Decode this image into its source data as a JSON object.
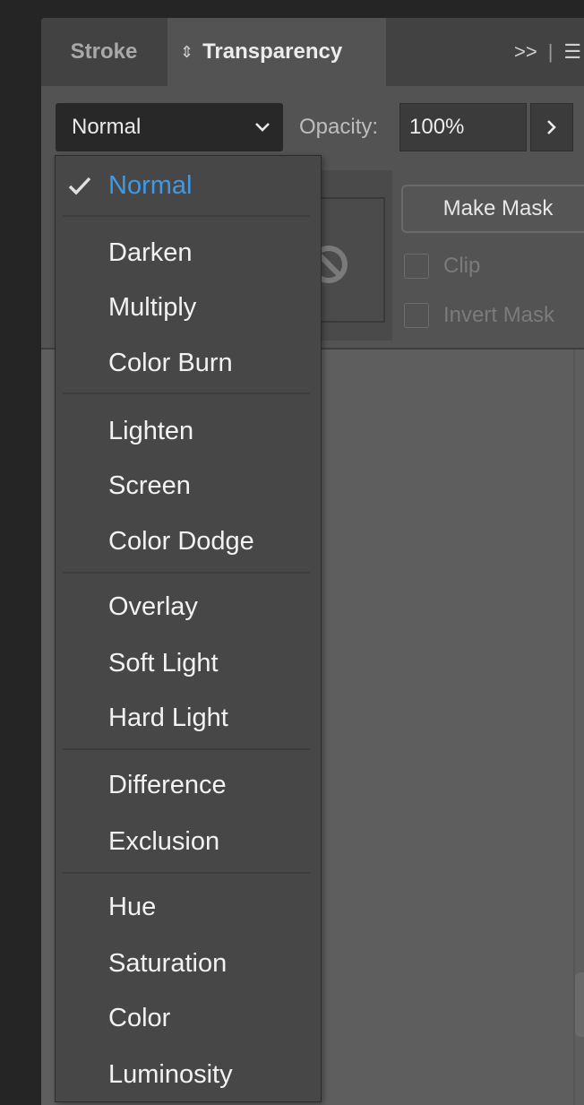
{
  "tabs": {
    "stroke": "Stroke",
    "transparency": "Transparency",
    "more": ">>",
    "separator": "|",
    "menu": "☰"
  },
  "controls": {
    "blend_mode": "Normal",
    "opacity_label": "Opacity:",
    "opacity_value": "100%",
    "make_mask": "Make Mask",
    "clip": "Clip",
    "invert_mask": "Invert Mask"
  },
  "menu": {
    "selected_check": "✓",
    "items": [
      "Normal",
      "Darken",
      "Multiply",
      "Color Burn",
      "Lighten",
      "Screen",
      "Color Dodge",
      "Overlay",
      "Soft Light",
      "Hard Light",
      "Difference",
      "Exclusion",
      "Hue",
      "Saturation",
      "Color",
      "Luminosity"
    ]
  },
  "colors": {
    "accent": "#3f9ae6",
    "menu_bg": "#474747",
    "panel_bg": "#5e5e5e"
  }
}
